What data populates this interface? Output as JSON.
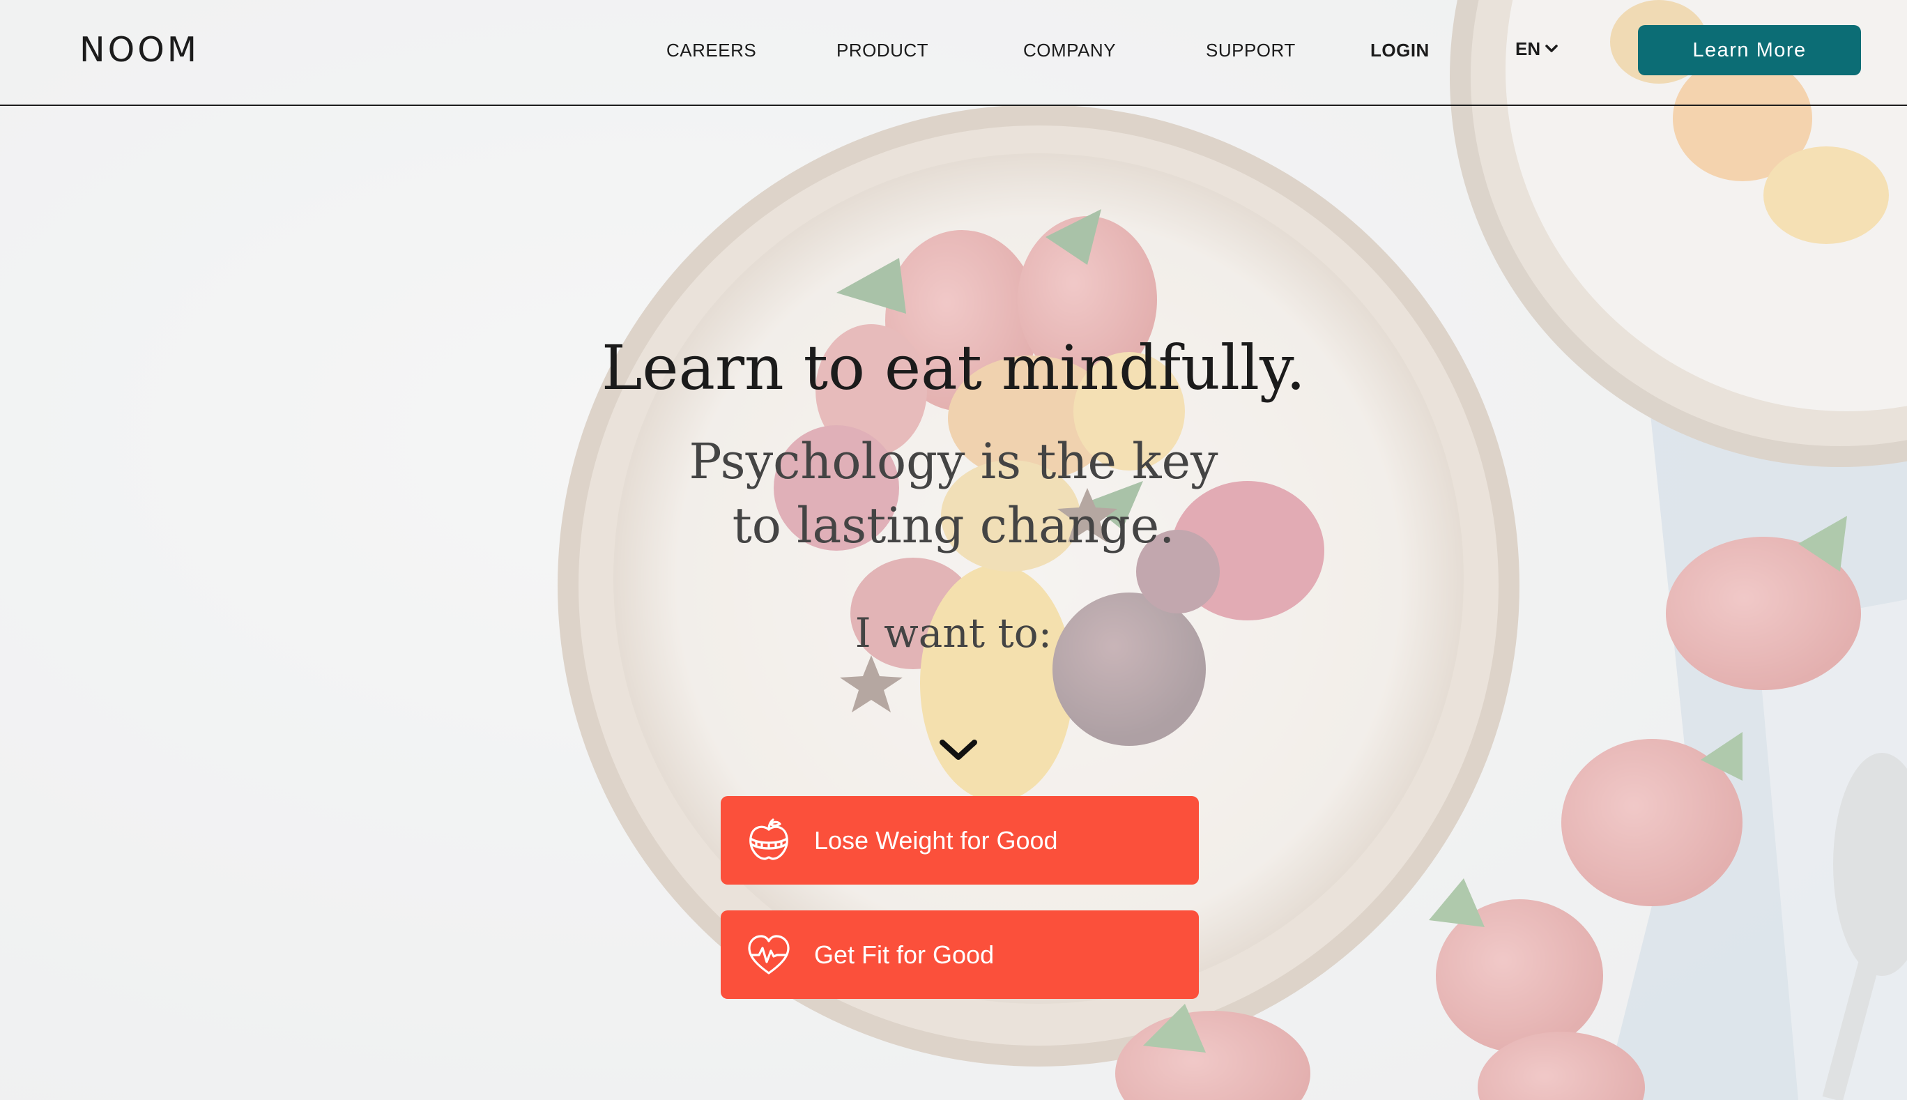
{
  "header": {
    "logo": "NOOM",
    "nav": {
      "careers": "CAREERS",
      "product": "PRODUCT",
      "company": "COMPANY",
      "support": "SUPPORT",
      "login": "LOGIN"
    },
    "language": "EN",
    "cta_label": "Learn More"
  },
  "hero": {
    "title": "Learn to eat mindfully.",
    "subtitle_line1": "Psychology is the key",
    "subtitle_line2": "to lasting change.",
    "prompt": "I want to:"
  },
  "goals": [
    {
      "label": "Lose Weight for Good",
      "icon": "apple-measuring-tape-icon"
    },
    {
      "label": "Get Fit for Good",
      "icon": "heart-heartbeat-icon"
    }
  ],
  "colors": {
    "brand_teal": "#0c6d75",
    "goal_button": "#fb503b",
    "text_dark": "#1b1b1b"
  }
}
